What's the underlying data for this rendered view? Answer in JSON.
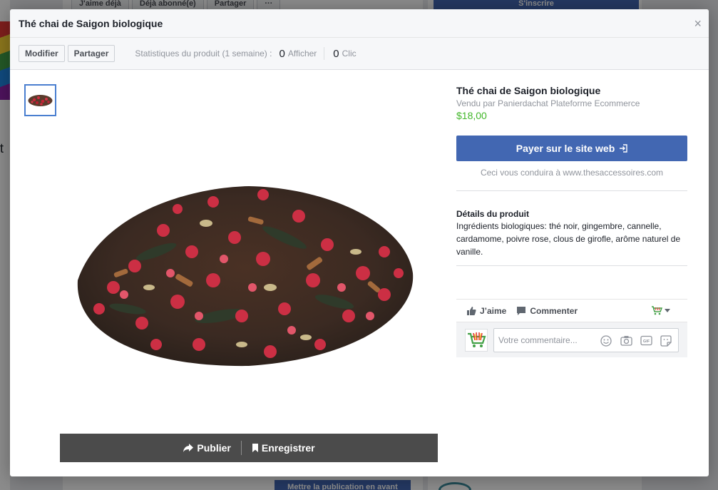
{
  "background": {
    "buttons": [
      "J'aime déjà",
      "Déjà abonné(e)",
      "Partager",
      "···"
    ],
    "top_right_button": "S'inscrire",
    "promote_button": "Mettre la publication en avant",
    "left_fragment": "t"
  },
  "modal": {
    "title": "Thé chai de Saigon biologique",
    "close_glyph": "×",
    "toolbar": {
      "edit_label": "Modifier",
      "share_label": "Partager",
      "stats_label": "Statistiques du produit (1 semaine) :",
      "views_count": "0",
      "views_label": "Afficher",
      "clicks_count": "0",
      "clicks_label": "Clic"
    },
    "media": {
      "publish_label": "Publier",
      "save_label": "Enregistrer"
    },
    "product": {
      "name": "Thé chai de Saigon biologique",
      "seller": "Vendu par Panierdachat Plateforme Ecommerce",
      "price": "$18,00",
      "pay_button": "Payer sur le site web",
      "redirect_note": "Ceci vous conduira à www.thesaccessoires.com",
      "details_heading": "Détails du produit",
      "details_text": "Ingrédients biologiques: thé noir, gingembre, cannelle, cardamome, poivre rose, clous de girofle, arôme naturel de vanille."
    },
    "social": {
      "like_label": "J’aime",
      "comment_label": "Commenter",
      "comment_placeholder": "Votre commentaire...",
      "gif_label": "GIF"
    }
  },
  "colors": {
    "brand_blue": "#4267b2",
    "price_green": "#42b72a",
    "action_bar": "#4b4b4b"
  }
}
